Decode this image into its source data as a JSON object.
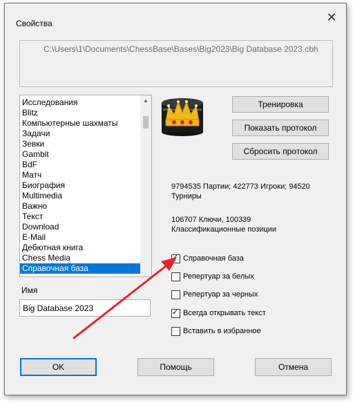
{
  "dialog": {
    "title": "Свойства",
    "close_glyph": "✕",
    "path": "C:\\Users\\1\\Documents\\ChessBase\\Bases\\Big2023\\Big Database 2023.cbh"
  },
  "list": {
    "items": [
      "Исследования",
      "Blitz",
      "Компьютерные шахматы",
      "Задачи",
      "Зевки",
      "Gambit",
      "BdF",
      "Матч",
      "Биография",
      "Multimedia",
      "Важно",
      "Текст",
      "Download",
      "E-Mail",
      "Дебютная книга",
      "Chess Media",
      "Справочная база"
    ],
    "selected_index": 16,
    "scroll_up_icon": "triangle-up"
  },
  "buttons": {
    "training": "Тренировка",
    "show_log": "Показать протокол",
    "reset_log": "Сбросить протокол",
    "ok": "OK",
    "help": "Помощь",
    "cancel": "Отмена"
  },
  "info": {
    "line1": "9794535 Партии; 422773 Игроки; 94520",
    "line2": "Турниры",
    "line3": "106707 Ключи, 100339",
    "line4": "Классификационные позиции"
  },
  "checkboxes": [
    {
      "label": "Справочная база",
      "checked": true
    },
    {
      "label": "Репертуар за белых",
      "checked": false
    },
    {
      "label": "Репертуар за черных",
      "checked": false
    },
    {
      "label": "Всегда открывать текст",
      "checked": true
    },
    {
      "label": "Вставить в избранное",
      "checked": false
    }
  ],
  "name_field": {
    "label": "Имя",
    "value": "Big Database 2023"
  },
  "colors": {
    "selection": "#0078d7",
    "arrow": "#e8202a",
    "logo_gold": "#f2b81a"
  }
}
